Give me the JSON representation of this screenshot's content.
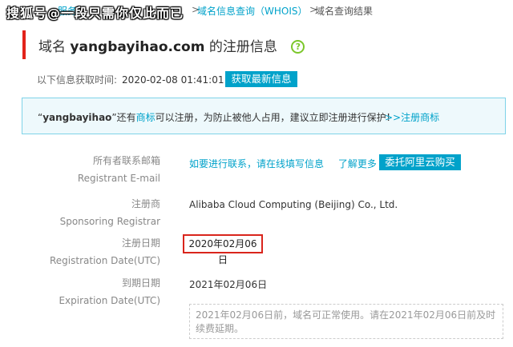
{
  "watermark": "搜狐号@一段只需你仅此而已",
  "breadcrumb": {
    "item1": "服务",
    "sep1": ">",
    "item2": "域名信息查询（WHOIS）",
    "sep2": ">",
    "current": "域名查询结果"
  },
  "title": {
    "prefix": "域名",
    "domain": "yangbayihao.com",
    "suffix": "的注册信息",
    "help_glyph": "?"
  },
  "fetch": {
    "label": "以下信息获取时间:",
    "time": "2020-02-08 01:41:01",
    "refresh_button": "获取最新信息"
  },
  "notice": {
    "open_quote": "“",
    "name": "yangbayihao",
    "close_quote": "”",
    "text1": "还有",
    "trademark_link": "商标",
    "text2": "可以注册，为防止被他人占用，建议立即注册进行保护！",
    "register_link": ">>注册商标"
  },
  "details": {
    "email": {
      "label_cn": "所有者联系邮箱",
      "label_en": "Registrant E-mail",
      "contact_link": "如要进行联系，请在线填写信息",
      "more_link": "了解更多",
      "entrust_button": "委托阿里云购买"
    },
    "registrar": {
      "label_cn": "注册商",
      "label_en": "Sponsoring Registrar",
      "value": "Alibaba Cloud Computing (Beijing) Co., Ltd."
    },
    "registration": {
      "label_cn": "注册日期",
      "label_en": "Registration Date(UTC)",
      "value": "2020年02月06日"
    },
    "expiration": {
      "label_cn": "到期日期",
      "label_en": "Expiration Date(UTC)",
      "value": "2021年02月06日",
      "note": "2021年02月06日前，域名可正常使用。请在2021年02月06日前及时续费延期。"
    }
  },
  "colors": {
    "accent": "#00a2ca",
    "title_bar": "#e2231a",
    "highlight_border": "#d9251c",
    "help_icon": "#7cc72b",
    "notice_bg": "#eef9fc"
  }
}
